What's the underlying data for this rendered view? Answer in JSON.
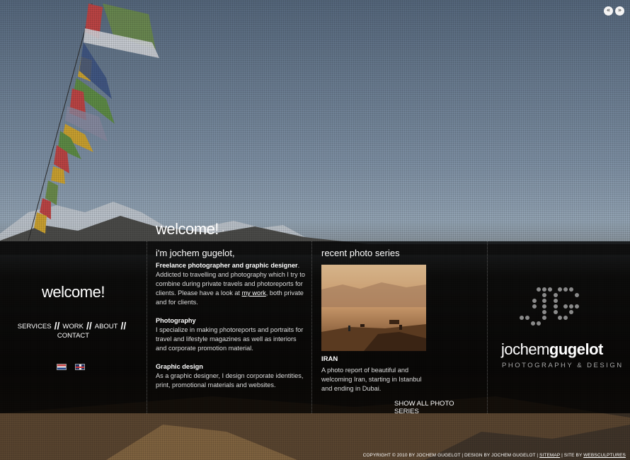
{
  "slider": {
    "prev_icon": "«",
    "next_icon": "»"
  },
  "hero": {
    "heading": "welcome!",
    "dot": "·"
  },
  "left": {
    "heading": "welcome!",
    "nav": [
      {
        "label": "SERVICES"
      },
      {
        "label": "WORK"
      },
      {
        "label": "ABOUT"
      },
      {
        "label": "CONTACT"
      }
    ],
    "separator": "//",
    "languages": [
      "nl-flag-icon",
      "uk-flag-icon"
    ]
  },
  "intro": {
    "heading": "i'm jochem gugelot,",
    "p1_bold": "Freelance photographer and graphic designer",
    "p1_text": ". Addicted to travelling and photography which I try to combine during private travels and photoreports for clients. Please have a look at ",
    "p1_link": "my work",
    "p1_tail": ", both private and for clients.",
    "photo_title": "Photography",
    "photo_text": "I specialize in making photoreports and portraits for travel and lifestyle magazines as well as interiors and corporate promotion material.",
    "design_title": "Graphic design",
    "design_text": "As a graphic designer, I design corporate identities, print, promotional materials and websites."
  },
  "series": {
    "heading": "recent photo series",
    "title": "IRAN",
    "text": "A photo report of beautiful and welcoming Iran, starting in Istanbul and ending in Dubai.",
    "show_all": "SHOW ALL PHOTO SERIES"
  },
  "logo": {
    "name_light": "jochem",
    "name_bold": "gugelot",
    "subtitle": "PHOTOGRAPHY & DESIGN"
  },
  "footer": {
    "text1": "COPYRIGHT © 2010 BY JOCHEM GUGELOT | DESIGN BY JOCHEM GUGELOT | ",
    "sitemap": "SITEMAP",
    "text2": " | SITE BY ",
    "credit": "WEBSCULPTURES"
  },
  "colors": {
    "panel": "#000000",
    "text": "#dddddd",
    "heading": "#ffffff"
  }
}
